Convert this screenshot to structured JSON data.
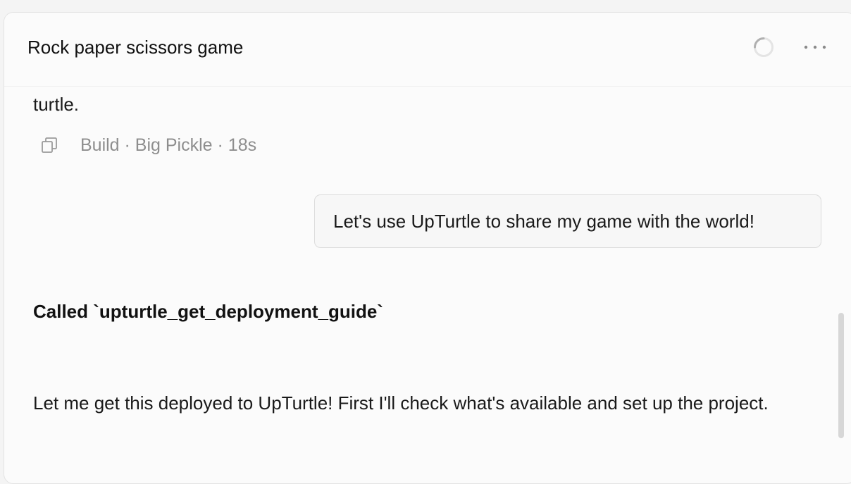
{
  "header": {
    "title": "Rock paper scissors game",
    "more_label": "···"
  },
  "message_prev": {
    "tail_text": "turtle.",
    "meta": "Build · Big Pickle · 18s"
  },
  "user_message": {
    "text": "Let's use UpTurtle to share my game with the world!"
  },
  "tool_call": {
    "text": "Called `upturtle_get_deployment_guide`"
  },
  "assistant_message": {
    "text": "Let me get this deployed to UpTurtle! First I'll check what's available and set up the project."
  },
  "colors": {
    "panel_bg": "#fbfbfb",
    "meta_text": "#8e8e8e",
    "bubble_bg": "#f7f7f7",
    "bubble_border": "#dcdcdc",
    "scrollbar": "#d7d7d7"
  },
  "icons": {
    "spinner": "loading-spinner-icon",
    "more": "more-horizontal-icon",
    "copy": "copy-icon"
  }
}
